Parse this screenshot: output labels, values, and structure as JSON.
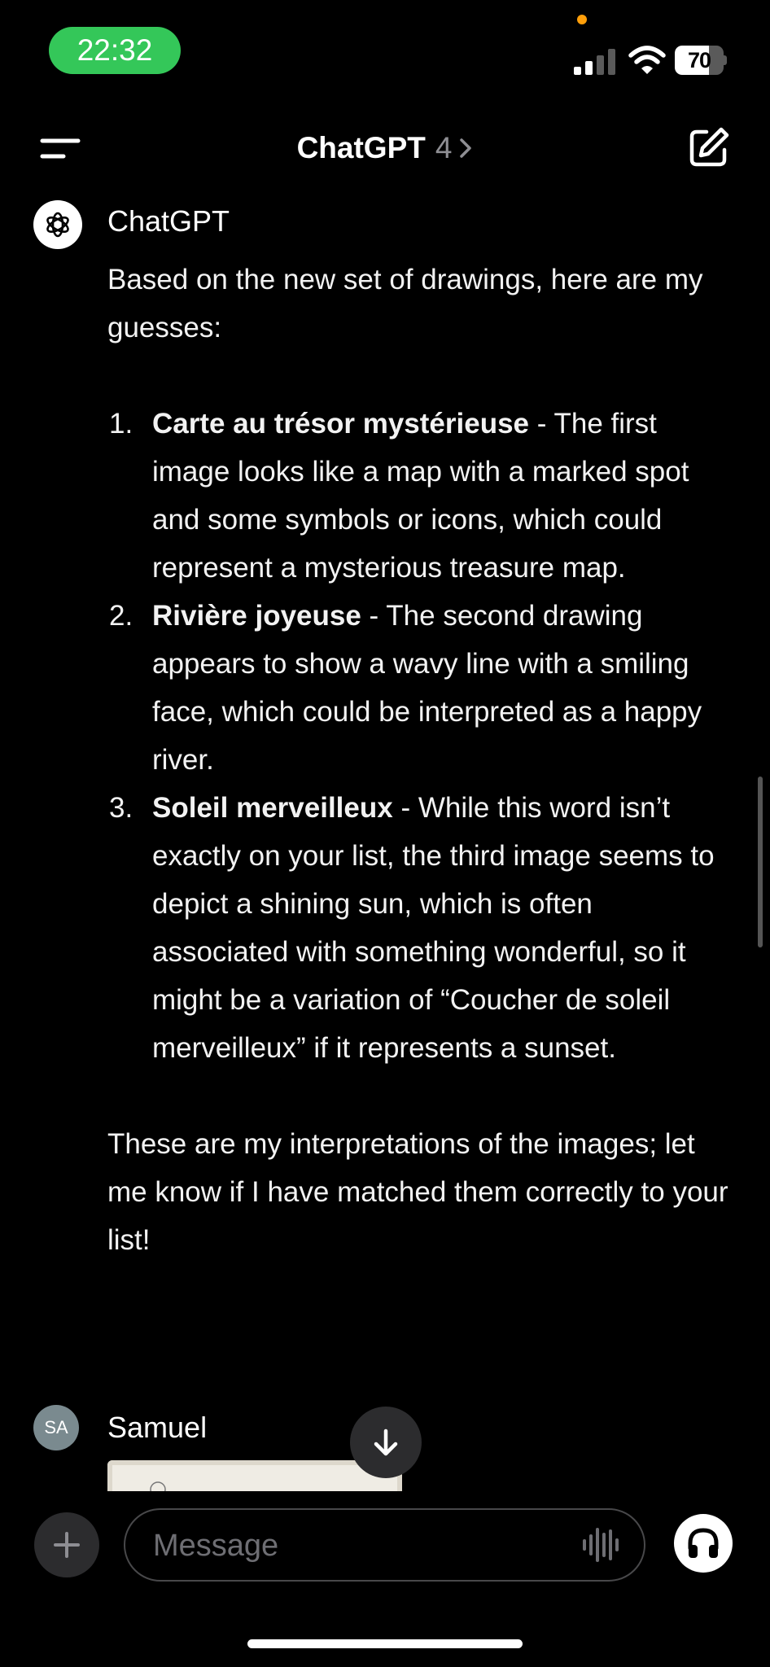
{
  "status_bar": {
    "time": "22:32",
    "battery_text": "70",
    "battery_level": 0.7,
    "icons": [
      "signal-icon",
      "wifi-icon",
      "battery-icon"
    ]
  },
  "nav": {
    "title": "ChatGPT",
    "model": "4",
    "icons": [
      "menu-icon",
      "chevron-right-icon",
      "compose-icon"
    ]
  },
  "conversation": {
    "assistant": {
      "name": "ChatGPT",
      "intro": "Based on the new set of drawings, here are my guesses:",
      "guesses": [
        {
          "number": "1.",
          "title": "Carte au trésor mystérieuse",
          "text": " - The first image looks like a map with a marked spot and some symbols or icons, which could represent a mysterious treasure map."
        },
        {
          "number": "2.",
          "title": "Rivière joyeuse",
          "text": " - The second drawing appears to show a wavy line with a smiling face, which could be interpreted as a happy river."
        },
        {
          "number": "3.",
          "title": "Soleil merveilleux",
          "text": " - While this word isn’t exactly on your list, the third image seems to depict a shining sun, which is often associated with something wonderful, so it might be a variation of “Coucher de soleil merveilleux” if it represents a sunset."
        }
      ],
      "outro": "These are my interpretations of the images; let me know if I have matched them correctly to your list!"
    },
    "user": {
      "initials": "SA",
      "name": "Samuel"
    }
  },
  "composer": {
    "placeholder": "Message",
    "icons": [
      "plus-icon",
      "voice-waveform-icon",
      "headphones-icon"
    ]
  },
  "colors": {
    "background": "#000000",
    "time_pill": "#34c759",
    "privacy_dot": "#ff9f0a",
    "secondary_text": "#8e8e93",
    "control_bg": "#2c2c2e"
  }
}
